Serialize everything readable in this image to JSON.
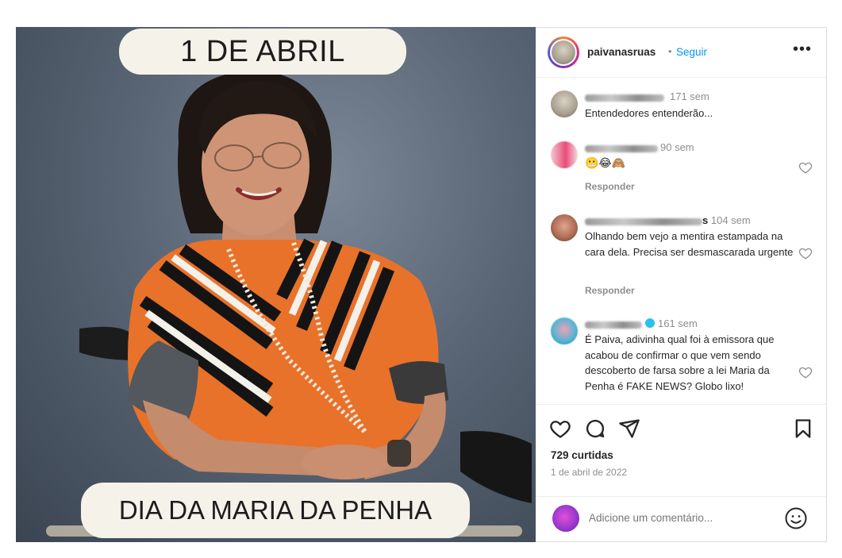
{
  "post_image": {
    "banner_top": "1 DE ABRIL",
    "banner_bottom": "DIA DA MARIA DA PENHA"
  },
  "header": {
    "username": "paivanasruas",
    "separator": "•",
    "follow_label": "Seguir",
    "more_label": "•••"
  },
  "comments": [
    {
      "time": "171 sem",
      "text": "Entendedores entenderão...",
      "avatar_icon": "user-avatar-icon"
    },
    {
      "time": "90 sem",
      "text": "😬😂🙈",
      "reply_label": "Responder",
      "avatar_icon": "user-avatar-icon"
    },
    {
      "time": "104 sem",
      "name_suffix": "s",
      "text": "Olhando bem vejo a mentira estampada na cara dela. Precisa ser desmascarada urgente",
      "reply_label": "Responder",
      "avatar_icon": "user-avatar-icon"
    },
    {
      "time": "161 sem",
      "text": "É Paiva, adivinha qual foi à emissora que acabou de confirmar o que vem sendo descoberto de farsa sobre a lei Maria da Penha é FAKE NEWS? Globo lixo!",
      "avatar_icon": "user-avatar-icon"
    }
  ],
  "actions": {
    "icons": [
      "heart-icon",
      "comment-icon",
      "share-icon",
      "bookmark-icon"
    ],
    "likes": "729 curtidas",
    "date": "1 de abril de 2022"
  },
  "add_comment": {
    "placeholder": "Adicione um comentário...",
    "emoji_icon": "emoji-icon"
  },
  "colors": {
    "link_blue": "#0095f6",
    "meta_gray": "#8e8e8e",
    "text": "#262626",
    "banner_bg": "#f5f2ea"
  }
}
